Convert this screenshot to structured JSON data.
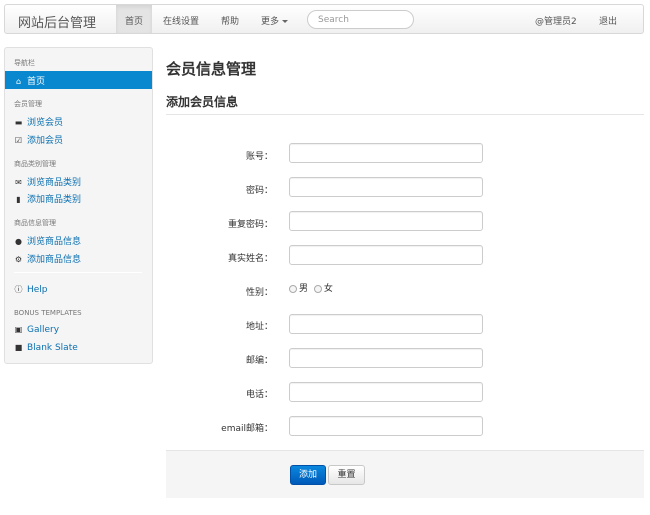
{
  "navbar": {
    "brand": "网站后台管理",
    "items": [
      {
        "label": "首页"
      },
      {
        "label": "在线设置"
      },
      {
        "label": "帮助"
      },
      {
        "label": "更多"
      }
    ],
    "search_placeholder": "Search",
    "user": "@管理员2",
    "logout": "退出"
  },
  "sidebar": {
    "nav_header": "导航栏",
    "home": "首页",
    "member_header": "会员管理",
    "browse_members": "浏览会员",
    "add_member": "添加会员",
    "category_header": "商品类别管理",
    "browse_categories": "浏览商品类别",
    "add_category": "添加商品类别",
    "product_header": "商品信息管理",
    "browse_products": "浏览商品信息",
    "add_product": "添加商品信息",
    "help": "Help",
    "bonus_header": "BONUS TEMPLATES",
    "gallery": "Gallery",
    "blank_slate": "Blank Slate"
  },
  "main": {
    "title": "会员信息管理",
    "section_title": "添加会员信息",
    "form": {
      "account_label": "账号：",
      "password_label": "密码：",
      "repeat_password_label": "重复密码：",
      "real_name_label": "真实姓名：",
      "gender_label": "性别：",
      "gender_male": "男",
      "gender_female": "女",
      "address_label": "地址：",
      "zip_label": "邮编：",
      "phone_label": "电话：",
      "email_label": "email邮箱："
    },
    "submit": "添加",
    "reset": "重置"
  },
  "colors": {
    "accent": "#0a88cf",
    "primary_button": "#0a6fd0",
    "link": "#0a6fb0"
  }
}
